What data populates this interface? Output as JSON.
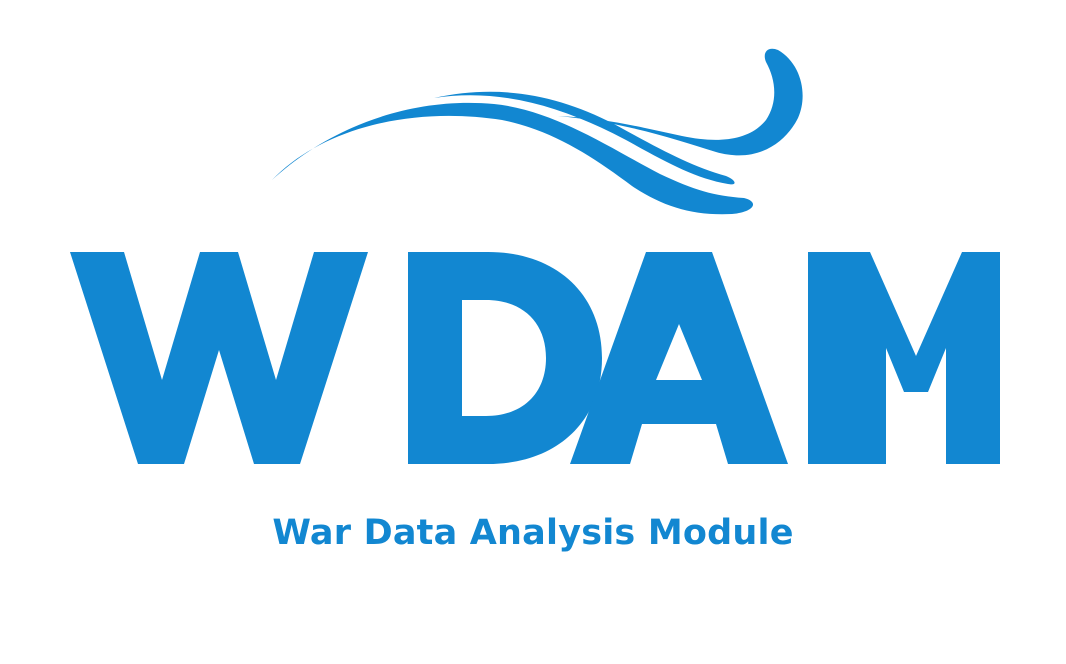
{
  "logo": {
    "wordmark": "WDAM",
    "tagline": "War Data Analysis Module",
    "brand_color": "#1287d1",
    "background_color": "#ffffff",
    "emblem": "wave-icon"
  }
}
